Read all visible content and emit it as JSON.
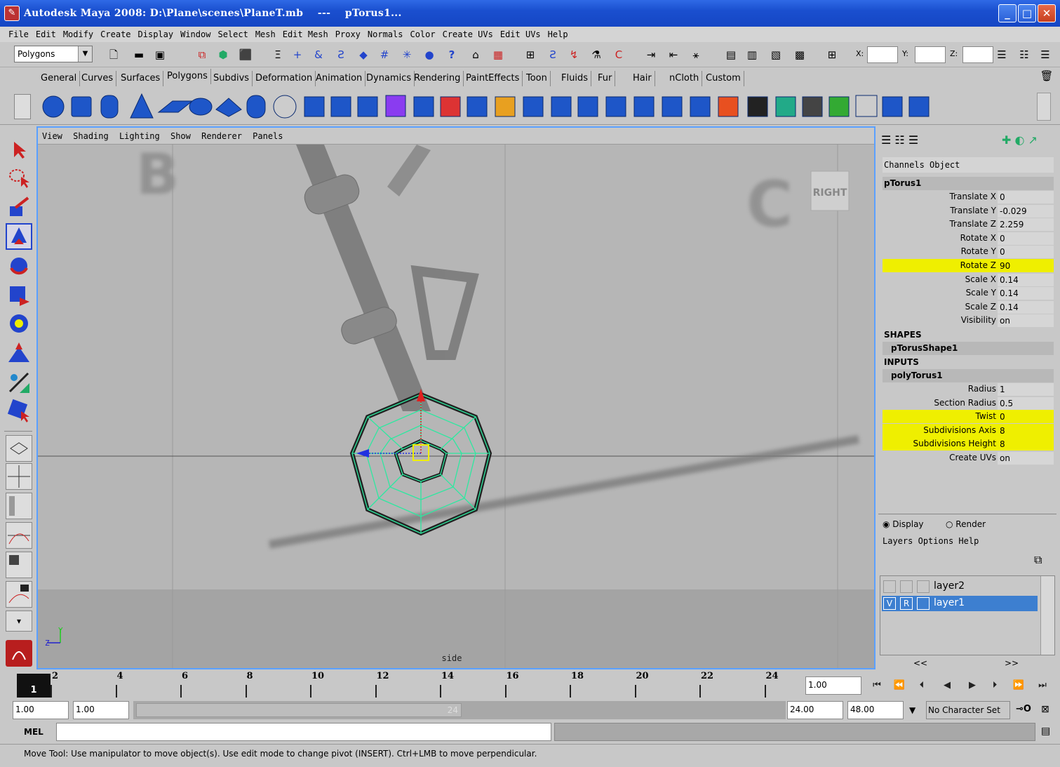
{
  "window": {
    "title": "Autodesk Maya 2008: D:\\Plane\\scenes\\PlaneT.mb    ---    pTorus1..."
  },
  "menubar": [
    "File",
    "Edit",
    "Modify",
    "Create",
    "Display",
    "Window",
    "Select",
    "Mesh",
    "Edit Mesh",
    "Proxy",
    "Normals",
    "Color",
    "Create UVs",
    "Edit UVs",
    "Help"
  ],
  "statusline": {
    "menu_set": "Polygons",
    "x_label": "X:",
    "y_label": "Y:",
    "z_label": "Z:"
  },
  "shelf_tabs": [
    "General",
    "Curves",
    "Surfaces",
    "Polygons",
    "Subdivs",
    "Deformation",
    "Animation",
    "Dynamics",
    "Rendering",
    "PaintEffects",
    "Toon",
    "Fluids",
    "Fur",
    "Hair",
    "nCloth",
    "Custom"
  ],
  "shelf_active": "Polygons",
  "viewport": {
    "menus": [
      "View",
      "Shading",
      "Lighting",
      "Show",
      "Renderer",
      "Panels"
    ],
    "camera_label": "side",
    "viewcube": "RIGHT",
    "axis_y": "Y",
    "axis_z": "Z"
  },
  "channelbox": {
    "tabs": [
      "Channels",
      "Object"
    ],
    "node": "pTorus1",
    "channels": [
      {
        "name": "Translate X",
        "value": "0",
        "hl": false
      },
      {
        "name": "Translate Y",
        "value": "-0.029",
        "hl": false
      },
      {
        "name": "Translate Z",
        "value": "2.259",
        "hl": false
      },
      {
        "name": "Rotate X",
        "value": "0",
        "hl": false
      },
      {
        "name": "Rotate Y",
        "value": "0",
        "hl": false
      },
      {
        "name": "Rotate Z",
        "value": "90",
        "hl": true
      },
      {
        "name": "Scale X",
        "value": "0.14",
        "hl": false
      },
      {
        "name": "Scale Y",
        "value": "0.14",
        "hl": false
      },
      {
        "name": "Scale Z",
        "value": "0.14",
        "hl": false
      },
      {
        "name": "Visibility",
        "value": "on",
        "hl": false
      }
    ],
    "shapes_header": "SHAPES",
    "shape_node": "pTorusShape1",
    "inputs_header": "INPUTS",
    "input_node": "polyTorus1",
    "inputs": [
      {
        "name": "Radius",
        "value": "1",
        "hl": false
      },
      {
        "name": "Section Radius",
        "value": "0.5",
        "hl": false
      },
      {
        "name": "Twist",
        "value": "0",
        "hl": true
      },
      {
        "name": "Subdivisions Axis",
        "value": "8",
        "hl": true
      },
      {
        "name": "Subdivisions Height",
        "value": "8",
        "hl": true
      },
      {
        "name": "Create UVs",
        "value": "on",
        "hl": false
      }
    ]
  },
  "layers": {
    "display_label": "Display",
    "render_label": "Render",
    "menus": [
      "Layers",
      "Options",
      "Help"
    ],
    "items": [
      {
        "name": "layer2",
        "v": "",
        "r": "",
        "selected": false
      },
      {
        "name": "layer1",
        "v": "V",
        "r": "R",
        "selected": true
      }
    ],
    "nav_left": "<<",
    "nav_right": ">>"
  },
  "timeline": {
    "current": "1",
    "ticks": [
      "2",
      "4",
      "6",
      "8",
      "10",
      "12",
      "14",
      "16",
      "18",
      "20",
      "22",
      "24"
    ],
    "current_time_field": "1.00"
  },
  "range": {
    "start": "1.00",
    "playback_start": "1.00",
    "slider_end_label": "24",
    "playback_end": "24.00",
    "end": "48.00",
    "character_set": "No Character Set"
  },
  "cmdline": {
    "label": "MEL"
  },
  "helpline": {
    "text": "Move Tool: Use manipulator to move object(s). Use edit mode to change pivot (INSERT).  Ctrl+LMB to move perpendicular."
  },
  "colors": {
    "highlight": "#efef00",
    "selection": "#3d7fd0",
    "wireframe": "#4ff0b0",
    "titlebar": "#1a4fcf"
  }
}
